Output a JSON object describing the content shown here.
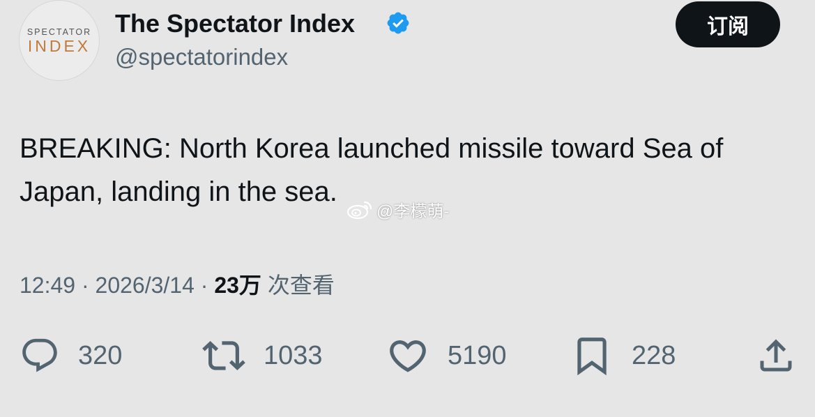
{
  "account": {
    "avatar_line1": "SPECTATOR",
    "avatar_line2": "INDEX",
    "display_name": "The Spectator Index",
    "handle": "@spectatorindex",
    "verified_icon": "verified-badge-icon",
    "subscribe_label": "订阅"
  },
  "tweet": {
    "text": "BREAKING: North Korea launched missile toward Sea of Japan, landing in the sea.",
    "time": "12:49",
    "separator1": " · ",
    "date": "2026/3/14",
    "separator2": " · ",
    "views_count": "23万",
    "views_label": " 次查看"
  },
  "watermark": {
    "text": "@李檬萌-",
    "icon": "weibo-icon"
  },
  "actions": {
    "reply": {
      "icon": "reply-icon",
      "count": "320"
    },
    "retweet": {
      "icon": "retweet-icon",
      "count": "1033"
    },
    "like": {
      "icon": "heart-icon",
      "count": "5190"
    },
    "bookmark": {
      "icon": "bookmark-icon",
      "count": "228"
    },
    "share": {
      "icon": "share-icon"
    }
  },
  "colors": {
    "background": "#e6e6e6",
    "text_primary": "#0f1419",
    "text_secondary": "#536471",
    "verified_blue": "#1d9bf0",
    "avatar_accent": "#c07a3a"
  }
}
